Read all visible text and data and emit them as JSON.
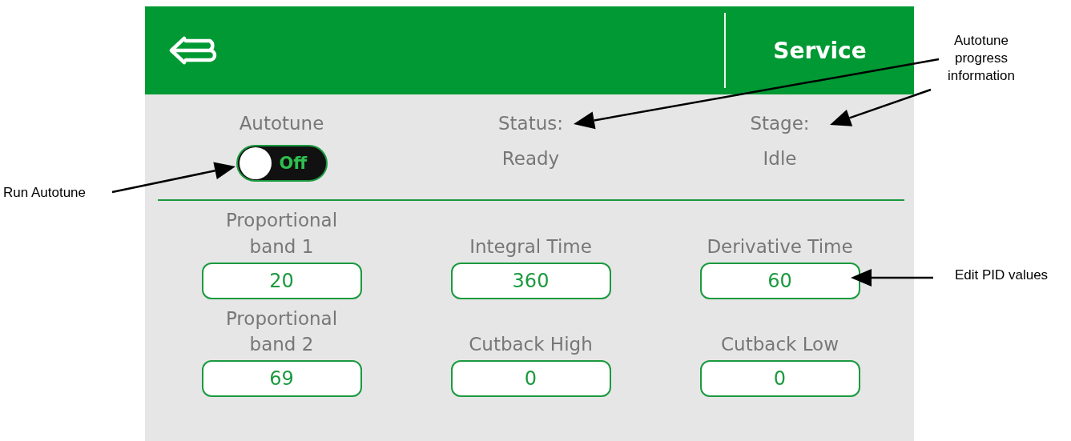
{
  "header": {
    "title": "Service"
  },
  "autotune": {
    "label": "Autotune",
    "on": false,
    "toggle_text": "Off"
  },
  "progress": [
    {
      "label": "Status:",
      "value": "Ready"
    },
    {
      "label": "Stage:",
      "value": "Idle"
    }
  ],
  "pid_fields": [
    {
      "label": "Proportional band 1",
      "value": "20"
    },
    {
      "label": "Integral Time",
      "value": "360"
    },
    {
      "label": "Derivative Time",
      "value": "60"
    },
    {
      "label": "Proportional band 2",
      "value": "69"
    },
    {
      "label": "Cutback High",
      "value": "0"
    },
    {
      "label": "Cutback Low",
      "value": "0"
    }
  ],
  "annotations": [
    {
      "text": "Run Autotune"
    },
    {
      "text": "Autotune progress information"
    },
    {
      "text": "Edit PID values"
    }
  ]
}
